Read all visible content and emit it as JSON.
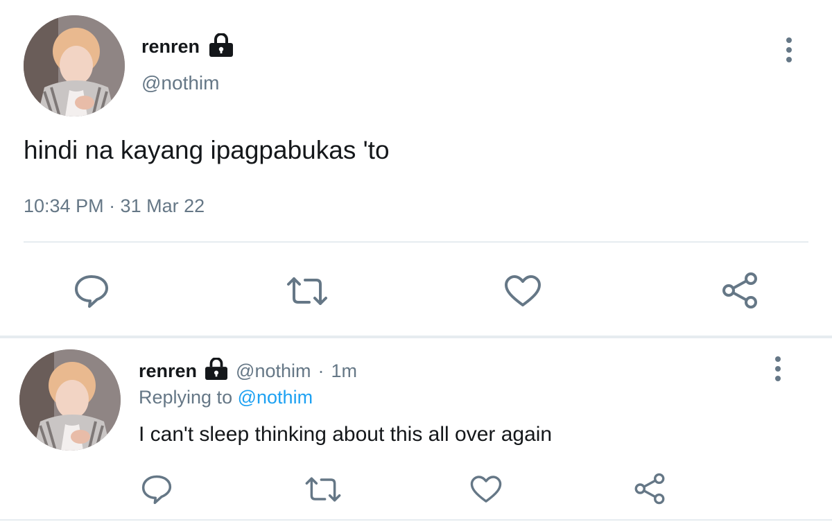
{
  "main_tweet": {
    "author_name": "renren",
    "author_handle": "@nothim",
    "text": "hindi na kayang ipagpabukas 'to",
    "timestamp": "10:34 PM · 31 Mar 22"
  },
  "reply_tweet": {
    "author_name": "renren",
    "author_handle": "@nothim",
    "separator": "·",
    "age": "1m",
    "replying_label": "Replying to",
    "replying_handle": "@nothim",
    "text": "I can't sleep thinking about this all over again"
  },
  "icons": {
    "lock": "lock-icon",
    "more": "more-vertical-icon",
    "reply": "reply-icon",
    "retweet": "retweet-icon",
    "like": "heart-icon",
    "share": "share-icon"
  },
  "colors": {
    "text": "#14171a",
    "secondary": "#657786",
    "link": "#1da1f2",
    "divider": "#e6ecf0"
  }
}
